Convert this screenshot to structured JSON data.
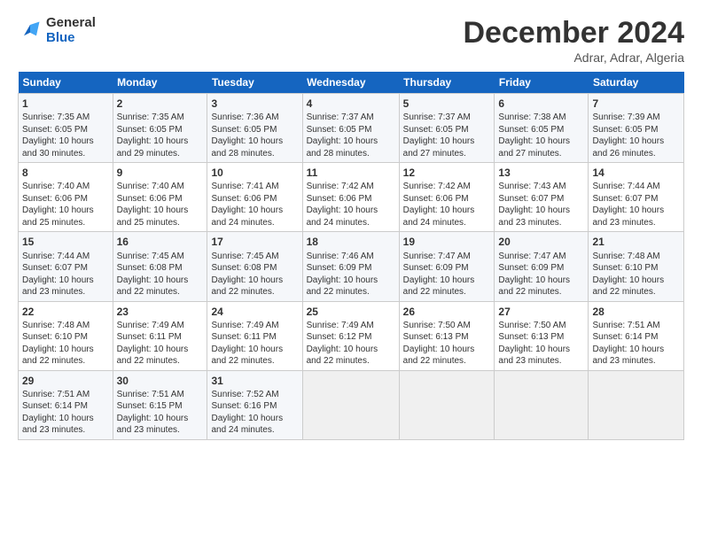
{
  "logo": {
    "line1": "General",
    "line2": "Blue"
  },
  "header": {
    "month": "December 2024",
    "location": "Adrar, Adrar, Algeria"
  },
  "days_of_week": [
    "Sunday",
    "Monday",
    "Tuesday",
    "Wednesday",
    "Thursday",
    "Friday",
    "Saturday"
  ],
  "weeks": [
    [
      {
        "day": "1",
        "info": "Sunrise: 7:35 AM\nSunset: 6:05 PM\nDaylight: 10 hours\nand 30 minutes."
      },
      {
        "day": "2",
        "info": "Sunrise: 7:35 AM\nSunset: 6:05 PM\nDaylight: 10 hours\nand 29 minutes."
      },
      {
        "day": "3",
        "info": "Sunrise: 7:36 AM\nSunset: 6:05 PM\nDaylight: 10 hours\nand 28 minutes."
      },
      {
        "day": "4",
        "info": "Sunrise: 7:37 AM\nSunset: 6:05 PM\nDaylight: 10 hours\nand 28 minutes."
      },
      {
        "day": "5",
        "info": "Sunrise: 7:37 AM\nSunset: 6:05 PM\nDaylight: 10 hours\nand 27 minutes."
      },
      {
        "day": "6",
        "info": "Sunrise: 7:38 AM\nSunset: 6:05 PM\nDaylight: 10 hours\nand 27 minutes."
      },
      {
        "day": "7",
        "info": "Sunrise: 7:39 AM\nSunset: 6:05 PM\nDaylight: 10 hours\nand 26 minutes."
      }
    ],
    [
      {
        "day": "8",
        "info": "Sunrise: 7:40 AM\nSunset: 6:06 PM\nDaylight: 10 hours\nand 25 minutes."
      },
      {
        "day": "9",
        "info": "Sunrise: 7:40 AM\nSunset: 6:06 PM\nDaylight: 10 hours\nand 25 minutes."
      },
      {
        "day": "10",
        "info": "Sunrise: 7:41 AM\nSunset: 6:06 PM\nDaylight: 10 hours\nand 24 minutes."
      },
      {
        "day": "11",
        "info": "Sunrise: 7:42 AM\nSunset: 6:06 PM\nDaylight: 10 hours\nand 24 minutes."
      },
      {
        "day": "12",
        "info": "Sunrise: 7:42 AM\nSunset: 6:06 PM\nDaylight: 10 hours\nand 24 minutes."
      },
      {
        "day": "13",
        "info": "Sunrise: 7:43 AM\nSunset: 6:07 PM\nDaylight: 10 hours\nand 23 minutes."
      },
      {
        "day": "14",
        "info": "Sunrise: 7:44 AM\nSunset: 6:07 PM\nDaylight: 10 hours\nand 23 minutes."
      }
    ],
    [
      {
        "day": "15",
        "info": "Sunrise: 7:44 AM\nSunset: 6:07 PM\nDaylight: 10 hours\nand 23 minutes."
      },
      {
        "day": "16",
        "info": "Sunrise: 7:45 AM\nSunset: 6:08 PM\nDaylight: 10 hours\nand 22 minutes."
      },
      {
        "day": "17",
        "info": "Sunrise: 7:45 AM\nSunset: 6:08 PM\nDaylight: 10 hours\nand 22 minutes."
      },
      {
        "day": "18",
        "info": "Sunrise: 7:46 AM\nSunset: 6:09 PM\nDaylight: 10 hours\nand 22 minutes."
      },
      {
        "day": "19",
        "info": "Sunrise: 7:47 AM\nSunset: 6:09 PM\nDaylight: 10 hours\nand 22 minutes."
      },
      {
        "day": "20",
        "info": "Sunrise: 7:47 AM\nSunset: 6:09 PM\nDaylight: 10 hours\nand 22 minutes."
      },
      {
        "day": "21",
        "info": "Sunrise: 7:48 AM\nSunset: 6:10 PM\nDaylight: 10 hours\nand 22 minutes."
      }
    ],
    [
      {
        "day": "22",
        "info": "Sunrise: 7:48 AM\nSunset: 6:10 PM\nDaylight: 10 hours\nand 22 minutes."
      },
      {
        "day": "23",
        "info": "Sunrise: 7:49 AM\nSunset: 6:11 PM\nDaylight: 10 hours\nand 22 minutes."
      },
      {
        "day": "24",
        "info": "Sunrise: 7:49 AM\nSunset: 6:11 PM\nDaylight: 10 hours\nand 22 minutes."
      },
      {
        "day": "25",
        "info": "Sunrise: 7:49 AM\nSunset: 6:12 PM\nDaylight: 10 hours\nand 22 minutes."
      },
      {
        "day": "26",
        "info": "Sunrise: 7:50 AM\nSunset: 6:13 PM\nDaylight: 10 hours\nand 22 minutes."
      },
      {
        "day": "27",
        "info": "Sunrise: 7:50 AM\nSunset: 6:13 PM\nDaylight: 10 hours\nand 23 minutes."
      },
      {
        "day": "28",
        "info": "Sunrise: 7:51 AM\nSunset: 6:14 PM\nDaylight: 10 hours\nand 23 minutes."
      }
    ],
    [
      {
        "day": "29",
        "info": "Sunrise: 7:51 AM\nSunset: 6:14 PM\nDaylight: 10 hours\nand 23 minutes."
      },
      {
        "day": "30",
        "info": "Sunrise: 7:51 AM\nSunset: 6:15 PM\nDaylight: 10 hours\nand 23 minutes."
      },
      {
        "day": "31",
        "info": "Sunrise: 7:52 AM\nSunset: 6:16 PM\nDaylight: 10 hours\nand 24 minutes."
      },
      {
        "day": "",
        "info": ""
      },
      {
        "day": "",
        "info": ""
      },
      {
        "day": "",
        "info": ""
      },
      {
        "day": "",
        "info": ""
      }
    ]
  ]
}
